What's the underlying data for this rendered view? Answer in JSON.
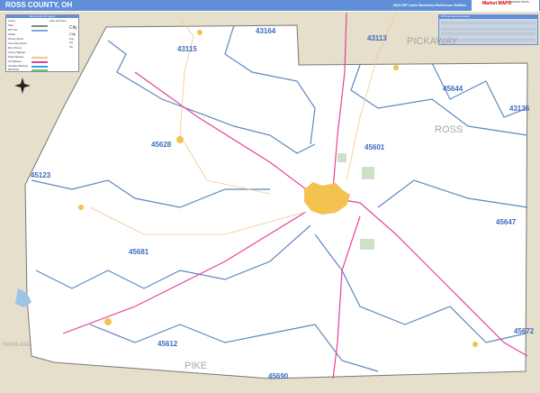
{
  "header": {
    "title": "ROSS COUNTY, OH",
    "edition": "2020 ZIP Code Business Reference Edition",
    "logo_text": "Market MAPS",
    "logo_right": "MARKET MAPS"
  },
  "legend": {
    "title": "Ross County, OH Legend",
    "rows": [
      "County",
      "State",
      "ZIP Code",
      "Hillside",
      "Primary Streets",
      "Secondary Streets",
      "Minor Streets",
      "County Highways",
      "State Highways",
      "US Highways",
      "Interstate Highways",
      "Rail Roads"
    ],
    "right_title": "Cities and Towns",
    "right_rows": [
      "City",
      "City",
      "City",
      "City",
      "City"
    ]
  },
  "zip_index": {
    "title": "ZIP Code Index/Grid Locator"
  },
  "zip_labels": [
    {
      "zip": "43164"
    },
    {
      "zip": "43115"
    },
    {
      "zip": "43113"
    },
    {
      "zip": "45644"
    },
    {
      "zip": "43135"
    },
    {
      "zip": "45628"
    },
    {
      "zip": "45601"
    },
    {
      "zip": "45123"
    },
    {
      "zip": "45647"
    },
    {
      "zip": "45681"
    },
    {
      "zip": "45612"
    },
    {
      "zip": "45672"
    },
    {
      "zip": "45690"
    }
  ],
  "county_labels": {
    "pickaway": "PICKAWAY",
    "ross": "ROSS",
    "pike": "PIKE",
    "highland": "HIGHLAND"
  },
  "colors": {
    "header": "#5f8fd8",
    "zip_boundary": "#5d88c0",
    "highway": "#e8409a",
    "city": "#f3c24f",
    "outside": "#e6dfcb"
  }
}
